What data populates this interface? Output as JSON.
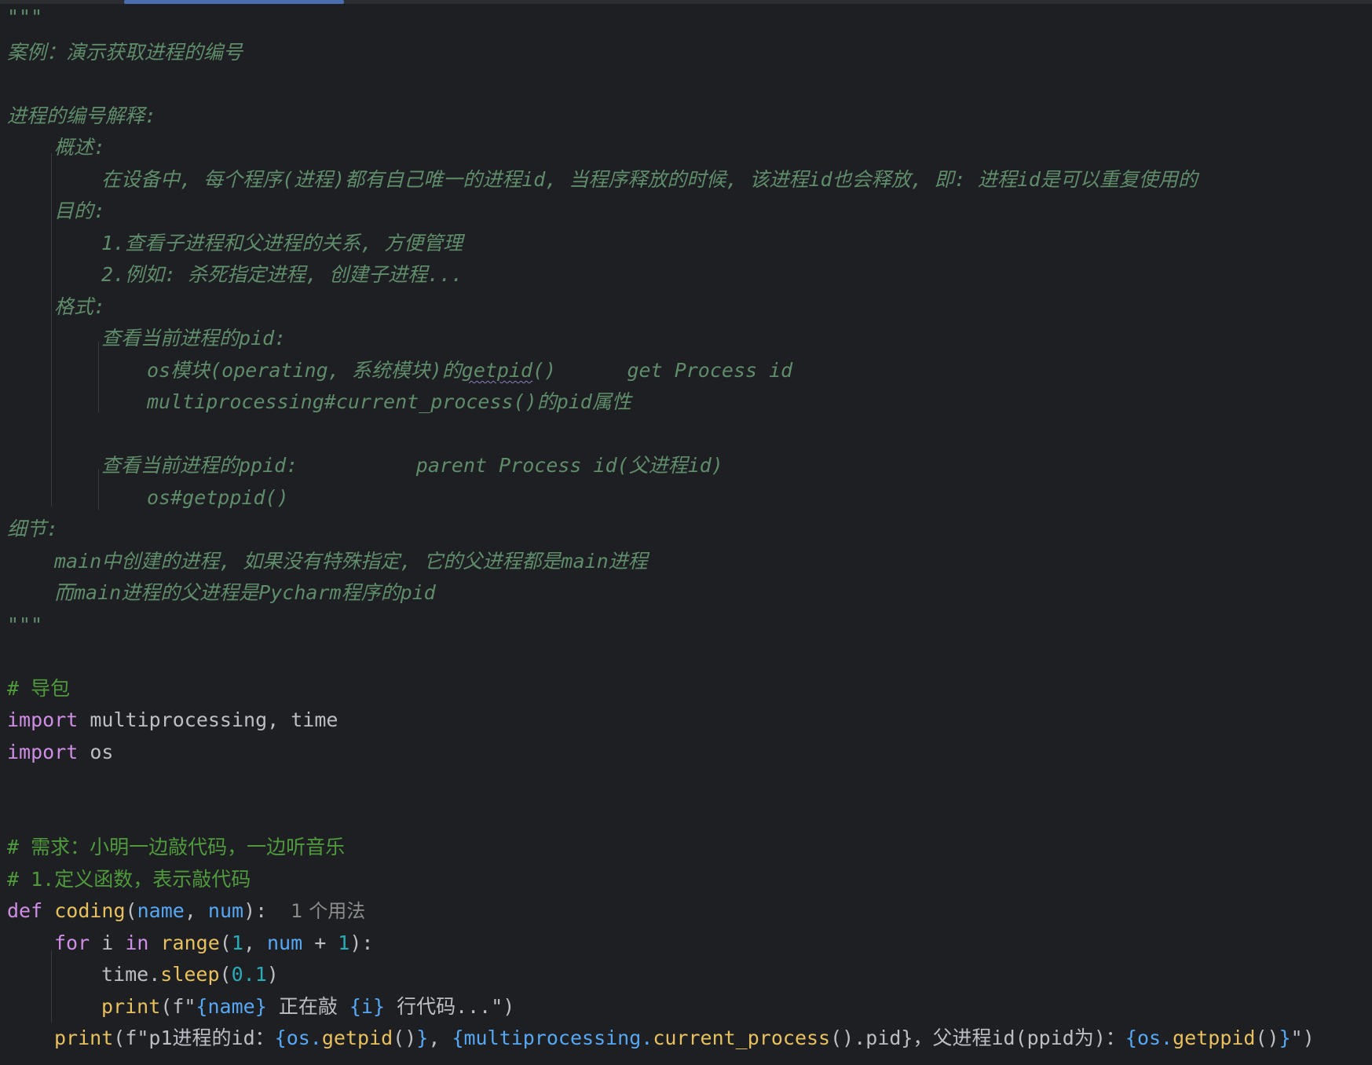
{
  "docstring": {
    "open": "\"\"\"",
    "title": "案例：演示获取进程的编号",
    "heading": "进程的编号解释:",
    "overview_label": "概述:",
    "overview_text": "在设备中, 每个程序(进程)都有自己唯一的进程id, 当程序释放的时候, 该进程id也会释放, 即: 进程id是可以重复使用的",
    "purpose_label": "目的:",
    "purpose_1": "1.查看子进程和父进程的关系, 方便管理",
    "purpose_2": "2.例如: 杀死指定进程, 创建子进程...",
    "format_label": "格式:",
    "pid_label": "查看当前进程的pid:",
    "pid_os_prefix": "os模块(operating, 系统模块)的",
    "pid_os_func": "getpid",
    "pid_os_suffix": "()      get Process id",
    "pid_mp": "multiprocessing#current_process()的pid属性",
    "ppid_label": "查看当前进程的ppid:          parent Process id(父进程id)",
    "ppid_os": "os#getppid()",
    "detail_label": "细节:",
    "detail_1": "main中创建的进程, 如果没有特殊指定, 它的父进程都是main进程",
    "detail_2": "而main进程的父进程是Pycharm程序的pid",
    "close": "\"\"\""
  },
  "code": {
    "comment_import": "# 导包",
    "kw_import": "import",
    "import_1_mods": " multiprocessing, time",
    "import_2_mods": " os",
    "comment_req": "# 需求：小明一边敲代码，一边听音乐",
    "comment_def": "# 1.定义函数，表示敲代码",
    "kw_def": "def",
    "func_name": "coding",
    "param_name": "name",
    "param_num": "num",
    "usage_hint": "1 个用法",
    "kw_for": "for",
    "loop_var": " i ",
    "kw_in": "in",
    "range_fn": "range",
    "one": "1",
    "sleep_obj": "time.",
    "sleep_fn": "sleep",
    "sleep_val": "0.1",
    "print_fn": "print",
    "brace_i": "{i}",
    "str_typing": " 正在敲 ",
    "str_lines": " 行代码...",
    "str_p1": "p1进程的id：",
    "str_parent": "，父进程id(ppid为)：",
    "os_getpid_obj": "{os.",
    "os_getpid_fn": "getpid",
    "mp_obj": "{multiprocessing.",
    "mp_fn": "current_process",
    "mp_tail": "().pid}",
    "os_getppid_fn": "getppid"
  }
}
